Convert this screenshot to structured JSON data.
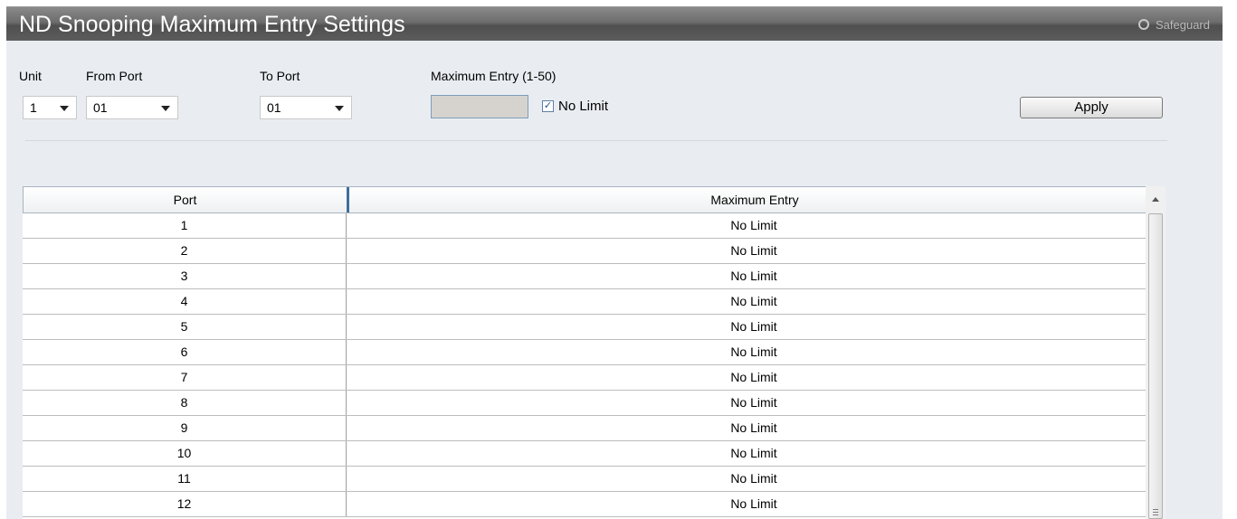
{
  "header": {
    "title": "ND Snooping Maximum Entry Settings",
    "safeguard_label": "Safeguard"
  },
  "form": {
    "unit_label": "Unit",
    "unit_value": "1",
    "from_port_label": "From Port",
    "from_port_value": "01",
    "to_port_label": "To Port",
    "to_port_value": "01",
    "max_entry_label": "Maximum Entry (1-50)",
    "max_entry_value": "",
    "no_limit_label": "No Limit",
    "no_limit_checked": true,
    "apply_label": "Apply"
  },
  "table": {
    "headers": [
      "Port",
      "Maximum Entry"
    ],
    "rows": [
      [
        "1",
        "No Limit"
      ],
      [
        "2",
        "No Limit"
      ],
      [
        "3",
        "No Limit"
      ],
      [
        "4",
        "No Limit"
      ],
      [
        "5",
        "No Limit"
      ],
      [
        "6",
        "No Limit"
      ],
      [
        "7",
        "No Limit"
      ],
      [
        "8",
        "No Limit"
      ],
      [
        "9",
        "No Limit"
      ],
      [
        "10",
        "No Limit"
      ],
      [
        "11",
        "No Limit"
      ],
      [
        "12",
        "No Limit"
      ]
    ]
  },
  "colors": {
    "title_bar": "#5c5c5c",
    "panel_bg": "#e9edf1",
    "header_separator": "#3e6f9b"
  },
  "icons": {
    "safeguard": "radio-icon",
    "dropdown": "chevron-down-icon",
    "scroll_up": "arrow-up-icon"
  }
}
